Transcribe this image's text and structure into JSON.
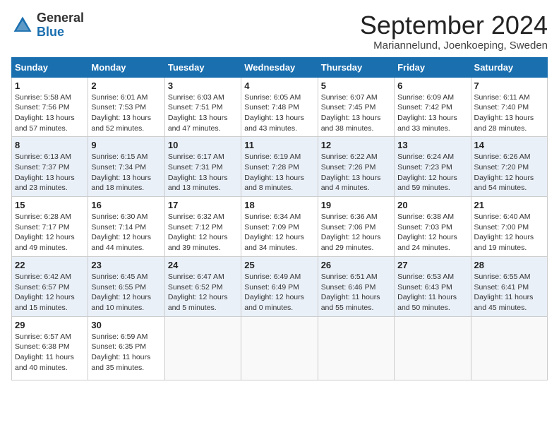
{
  "header": {
    "logo_general": "General",
    "logo_blue": "Blue",
    "month_title": "September 2024",
    "location": "Mariannelund, Joenkoeping, Sweden"
  },
  "calendar": {
    "days_of_week": [
      "Sunday",
      "Monday",
      "Tuesday",
      "Wednesday",
      "Thursday",
      "Friday",
      "Saturday"
    ],
    "weeks": [
      [
        {
          "day": "1",
          "sunrise": "Sunrise: 5:58 AM",
          "sunset": "Sunset: 7:56 PM",
          "daylight": "Daylight: 13 hours and 57 minutes."
        },
        {
          "day": "2",
          "sunrise": "Sunrise: 6:01 AM",
          "sunset": "Sunset: 7:53 PM",
          "daylight": "Daylight: 13 hours and 52 minutes."
        },
        {
          "day": "3",
          "sunrise": "Sunrise: 6:03 AM",
          "sunset": "Sunset: 7:51 PM",
          "daylight": "Daylight: 13 hours and 47 minutes."
        },
        {
          "day": "4",
          "sunrise": "Sunrise: 6:05 AM",
          "sunset": "Sunset: 7:48 PM",
          "daylight": "Daylight: 13 hours and 43 minutes."
        },
        {
          "day": "5",
          "sunrise": "Sunrise: 6:07 AM",
          "sunset": "Sunset: 7:45 PM",
          "daylight": "Daylight: 13 hours and 38 minutes."
        },
        {
          "day": "6",
          "sunrise": "Sunrise: 6:09 AM",
          "sunset": "Sunset: 7:42 PM",
          "daylight": "Daylight: 13 hours and 33 minutes."
        },
        {
          "day": "7",
          "sunrise": "Sunrise: 6:11 AM",
          "sunset": "Sunset: 7:40 PM",
          "daylight": "Daylight: 13 hours and 28 minutes."
        }
      ],
      [
        {
          "day": "8",
          "sunrise": "Sunrise: 6:13 AM",
          "sunset": "Sunset: 7:37 PM",
          "daylight": "Daylight: 13 hours and 23 minutes."
        },
        {
          "day": "9",
          "sunrise": "Sunrise: 6:15 AM",
          "sunset": "Sunset: 7:34 PM",
          "daylight": "Daylight: 13 hours and 18 minutes."
        },
        {
          "day": "10",
          "sunrise": "Sunrise: 6:17 AM",
          "sunset": "Sunset: 7:31 PM",
          "daylight": "Daylight: 13 hours and 13 minutes."
        },
        {
          "day": "11",
          "sunrise": "Sunrise: 6:19 AM",
          "sunset": "Sunset: 7:28 PM",
          "daylight": "Daylight: 13 hours and 8 minutes."
        },
        {
          "day": "12",
          "sunrise": "Sunrise: 6:22 AM",
          "sunset": "Sunset: 7:26 PM",
          "daylight": "Daylight: 13 hours and 4 minutes."
        },
        {
          "day": "13",
          "sunrise": "Sunrise: 6:24 AM",
          "sunset": "Sunset: 7:23 PM",
          "daylight": "Daylight: 12 hours and 59 minutes."
        },
        {
          "day": "14",
          "sunrise": "Sunrise: 6:26 AM",
          "sunset": "Sunset: 7:20 PM",
          "daylight": "Daylight: 12 hours and 54 minutes."
        }
      ],
      [
        {
          "day": "15",
          "sunrise": "Sunrise: 6:28 AM",
          "sunset": "Sunset: 7:17 PM",
          "daylight": "Daylight: 12 hours and 49 minutes."
        },
        {
          "day": "16",
          "sunrise": "Sunrise: 6:30 AM",
          "sunset": "Sunset: 7:14 PM",
          "daylight": "Daylight: 12 hours and 44 minutes."
        },
        {
          "day": "17",
          "sunrise": "Sunrise: 6:32 AM",
          "sunset": "Sunset: 7:12 PM",
          "daylight": "Daylight: 12 hours and 39 minutes."
        },
        {
          "day": "18",
          "sunrise": "Sunrise: 6:34 AM",
          "sunset": "Sunset: 7:09 PM",
          "daylight": "Daylight: 12 hours and 34 minutes."
        },
        {
          "day": "19",
          "sunrise": "Sunrise: 6:36 AM",
          "sunset": "Sunset: 7:06 PM",
          "daylight": "Daylight: 12 hours and 29 minutes."
        },
        {
          "day": "20",
          "sunrise": "Sunrise: 6:38 AM",
          "sunset": "Sunset: 7:03 PM",
          "daylight": "Daylight: 12 hours and 24 minutes."
        },
        {
          "day": "21",
          "sunrise": "Sunrise: 6:40 AM",
          "sunset": "Sunset: 7:00 PM",
          "daylight": "Daylight: 12 hours and 19 minutes."
        }
      ],
      [
        {
          "day": "22",
          "sunrise": "Sunrise: 6:42 AM",
          "sunset": "Sunset: 6:57 PM",
          "daylight": "Daylight: 12 hours and 15 minutes."
        },
        {
          "day": "23",
          "sunrise": "Sunrise: 6:45 AM",
          "sunset": "Sunset: 6:55 PM",
          "daylight": "Daylight: 12 hours and 10 minutes."
        },
        {
          "day": "24",
          "sunrise": "Sunrise: 6:47 AM",
          "sunset": "Sunset: 6:52 PM",
          "daylight": "Daylight: 12 hours and 5 minutes."
        },
        {
          "day": "25",
          "sunrise": "Sunrise: 6:49 AM",
          "sunset": "Sunset: 6:49 PM",
          "daylight": "Daylight: 12 hours and 0 minutes."
        },
        {
          "day": "26",
          "sunrise": "Sunrise: 6:51 AM",
          "sunset": "Sunset: 6:46 PM",
          "daylight": "Daylight: 11 hours and 55 minutes."
        },
        {
          "day": "27",
          "sunrise": "Sunrise: 6:53 AM",
          "sunset": "Sunset: 6:43 PM",
          "daylight": "Daylight: 11 hours and 50 minutes."
        },
        {
          "day": "28",
          "sunrise": "Sunrise: 6:55 AM",
          "sunset": "Sunset: 6:41 PM",
          "daylight": "Daylight: 11 hours and 45 minutes."
        }
      ],
      [
        {
          "day": "29",
          "sunrise": "Sunrise: 6:57 AM",
          "sunset": "Sunset: 6:38 PM",
          "daylight": "Daylight: 11 hours and 40 minutes."
        },
        {
          "day": "30",
          "sunrise": "Sunrise: 6:59 AM",
          "sunset": "Sunset: 6:35 PM",
          "daylight": "Daylight: 11 hours and 35 minutes."
        },
        null,
        null,
        null,
        null,
        null
      ]
    ]
  }
}
